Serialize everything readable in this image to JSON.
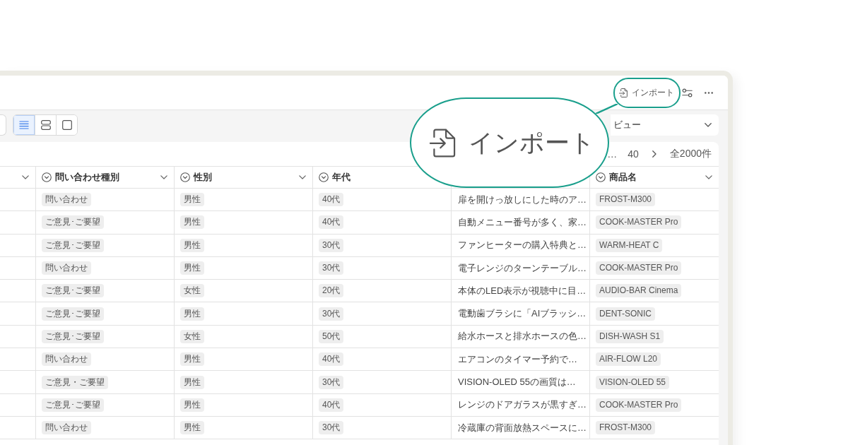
{
  "top_bar": {
    "import_button": {
      "label": "インポート"
    }
  },
  "view_toggle": {
    "options": [
      {
        "kind": "list",
        "selected": true
      },
      {
        "kind": "rows",
        "selected": false
      },
      {
        "kind": "single",
        "selected": false
      }
    ]
  },
  "view_select": {
    "value": "ビュー"
  },
  "pagination": {
    "ellipsis": "…",
    "page": "40",
    "total": "全2000件"
  },
  "table": {
    "columns": [
      {
        "caret": true
      },
      {
        "label": "問い合わせ種別",
        "caret": true
      },
      {
        "label": "性別",
        "caret": true
      },
      {
        "label": "年代",
        "caret": false
      },
      {},
      {
        "label": "商品名",
        "caret": true
      }
    ],
    "rows": [
      {
        "inquiry_type": "問い合わせ",
        "gender": "男性",
        "age_group": "40代",
        "column_5": "扉を開けっ放しにした時のア…",
        "product": "FROST-M300"
      },
      {
        "inquiry_type": "ご意見･ご要望",
        "gender": "男性",
        "age_group": "40代",
        "column_5": "自動メニュー番号が多く、家…",
        "product": "COOK-MASTER Pro"
      },
      {
        "inquiry_type": "ご意見･ご要望",
        "gender": "男性",
        "age_group": "30代",
        "column_5": "ファンヒーターの購入特典と…",
        "product": "WARM-HEAT C"
      },
      {
        "inquiry_type": "問い合わせ",
        "gender": "男性",
        "age_group": "30代",
        "column_5": "電子レンジのターンテーブル…",
        "product": "COOK-MASTER Pro"
      },
      {
        "inquiry_type": "ご意見･ご要望",
        "gender": "女性",
        "age_group": "20代",
        "column_5": "本体のLED表示が視聴中に目…",
        "product": "AUDIO-BAR Cinema"
      },
      {
        "inquiry_type": "ご意見･ご要望",
        "gender": "男性",
        "age_group": "30代",
        "column_5": "電動歯ブラシに「AIブラッシ…",
        "product": "DENT-SONIC"
      },
      {
        "inquiry_type": "ご意見･ご要望",
        "gender": "女性",
        "age_group": "50代",
        "column_5": "給水ホースと排水ホースの色…",
        "product": "DISH-WASH S1"
      },
      {
        "inquiry_type": "問い合わせ",
        "gender": "男性",
        "age_group": "40代",
        "column_5": "エアコンのタイマー予約で…",
        "product": "AIR-FLOW L20"
      },
      {
        "inquiry_type": "ご意見・ご要望",
        "gender": "男性",
        "age_group": "30代",
        "column_5": "VISION-OLED 55の画質は…",
        "product": "VISION-OLED 55"
      },
      {
        "inquiry_type": "ご意見･ご要望",
        "gender": "男性",
        "age_group": "40代",
        "column_5": "レンジのドアガラスが黒すぎ…",
        "product": "COOK-MASTER Pro"
      },
      {
        "inquiry_type": "問い合わせ",
        "gender": "男性",
        "age_group": "30代",
        "column_5": "冷蔵庫の背面放熱スペースに…",
        "product": "FROST-M300"
      }
    ]
  },
  "callout": {
    "label": "インポート"
  }
}
